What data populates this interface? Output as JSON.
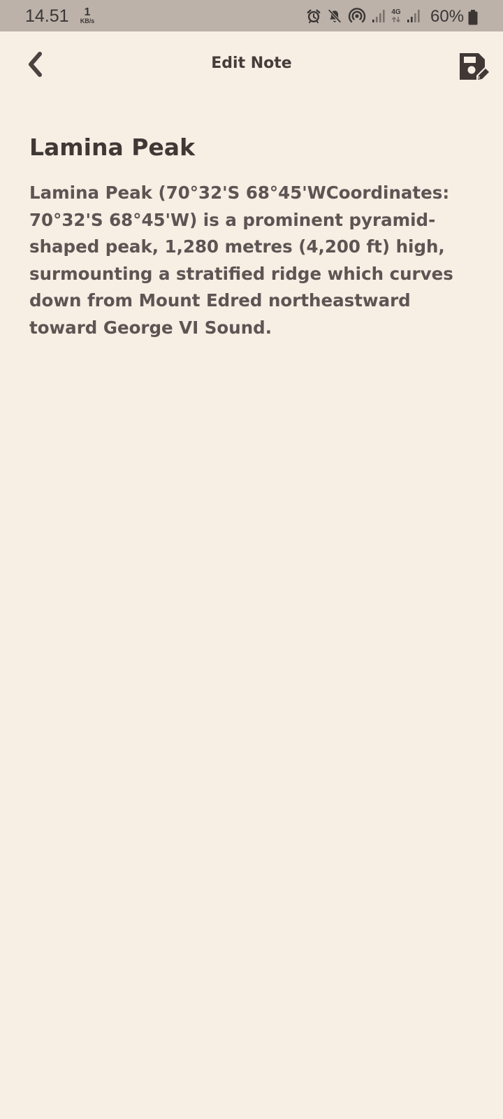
{
  "status_bar": {
    "time": "14.51",
    "net_speed_value": "1",
    "net_speed_unit": "KB/s",
    "network_type": "4G",
    "battery_percent": "60%",
    "icons": [
      "alarm-icon",
      "mute-icon",
      "hotspot-icon",
      "signal-icon",
      "network-4g-icon",
      "signal-icon",
      "battery-icon"
    ]
  },
  "app_bar": {
    "title": "Edit Note",
    "back_icon": "chevron-left-icon",
    "save_icon": "save-edit-icon"
  },
  "note": {
    "title": "Lamina Peak",
    "body": "Lamina Peak (70°32'S 68°45'WCoordinates: 70°32'S 68°45'W) is a prominent pyramid-shaped peak, 1,280 metres (4,200 ft) high, surmounting a stratified ridge which curves down from Mount Edred northeastward toward George VI Sound."
  },
  "colors": {
    "background": "#f7eee4",
    "status_bar": "#bcb2aa",
    "text_dark": "#3f3835",
    "text_body": "#5c5553"
  }
}
